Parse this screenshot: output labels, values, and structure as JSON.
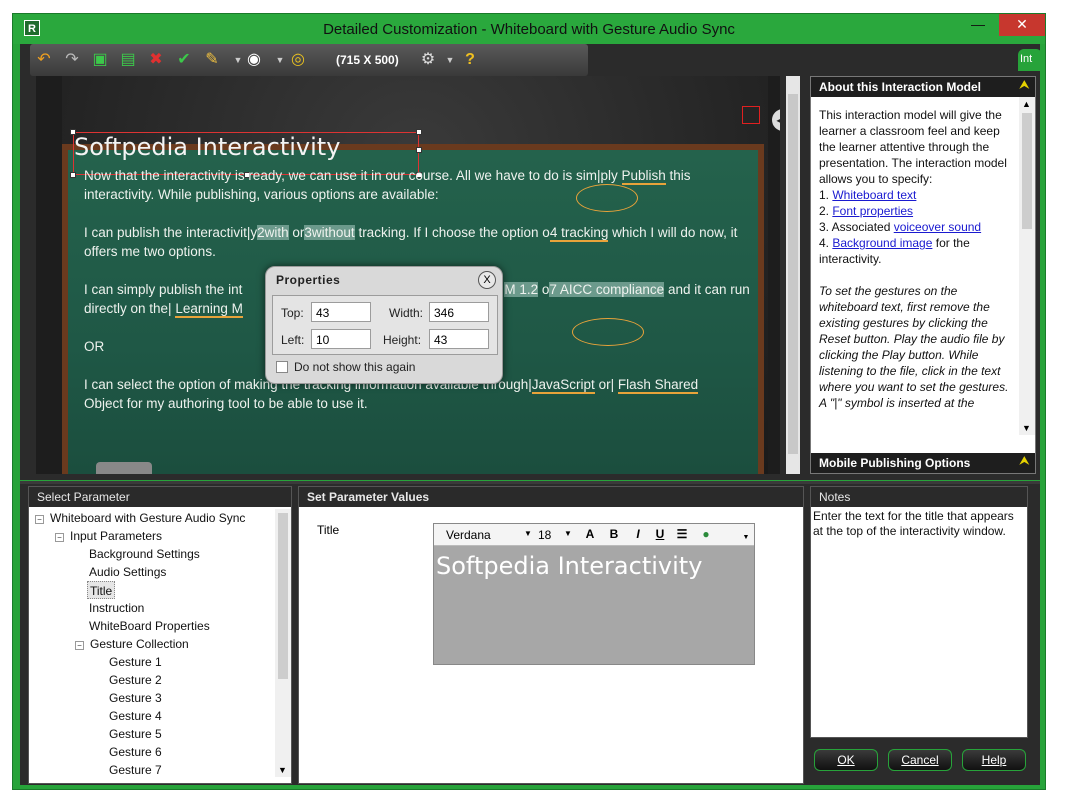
{
  "window": {
    "title": "Detailed Customization - Whiteboard with Gesture Audio Sync",
    "app_icon": "R",
    "minimize": "—",
    "close": "✕"
  },
  "toolbar": {
    "dimensions": "(715 X 500)",
    "tab_label": "Int",
    "icons": [
      "undo-icon",
      "redo-icon",
      "save-icon",
      "save-all-icon",
      "delete-icon",
      "check-icon",
      "paint-icon",
      "eye-icon",
      "target-icon",
      "gear-icon",
      "help-icon"
    ]
  },
  "whiteboard": {
    "title": "Softpedia Interactivity",
    "speaker": "◀)",
    "p1_a": "Now that the interactivity is ready, we can use it in our course. All we have to do is sim|ply ",
    "p1_hl": "Publish",
    "p1_b": " this interactivity. While publishing, various options are available:",
    "p2_a": "I can publish the interactivit|y",
    "p2_m1": "2with",
    "p2_b": " or",
    "p2_m2": "3without",
    "p2_c": " tracking. If I choose the option o",
    "p2_hl": "4 tracking",
    "p2_d": " which I will do now, it offers me two options.",
    "p3_a": "I can simply publish the int",
    "p3_m": "M 1.2",
    "p3_b": " o",
    "p3_c": "7 AICC compliance",
    "p3_d": " and it can run directly on the| ",
    "p3_hl": "Learning M",
    "p4": "OR",
    "p5_a": "I can select the option of making the tracking information available through|",
    "p5_hl1": "JavaScript",
    "p5_b": " or| ",
    "p5_hl2": "Flash Shared",
    "p5_c": "Object for my authoring tool to be able to use it."
  },
  "properties": {
    "title": "Properties",
    "close": "X",
    "top_label": "Top:",
    "top_value": "43",
    "width_label": "Width:",
    "width_value": "346",
    "left_label": "Left:",
    "left_value": "10",
    "height_label": "Height:",
    "height_value": "43",
    "no_show": "Do not show this again"
  },
  "about": {
    "header": "About this Interaction Model",
    "chevron": "⮝",
    "intro": "This interaction model will give the learner a classroom feel and keep the learner attentive through the presentation. The interaction model allows you to specify:",
    "item1_num": "1. ",
    "item1_link": "Whiteboard text",
    "item2_num": "2. ",
    "item2_link": "Font properties",
    "item3_num": "3. Associated ",
    "item3_link": "voiceover sound",
    "item4_num": "4. ",
    "item4_link": "Background image",
    "item4_tail": " for the interactivity.",
    "italic": "To set the gestures on the whiteboard text, first remove the existing gestures by clicking the Reset button. Play the audio file by clicking the Play button. While listening to the file, click in the text where you want to set the gestures. A \"|\" symbol is inserted at the",
    "footer": "Mobile Publishing Options"
  },
  "select_param": {
    "header": "Select Parameter",
    "root": "Whiteboard with Gesture Audio Sync",
    "input_params": "Input Parameters",
    "items": [
      "Background Settings",
      "Audio Settings",
      "Title",
      "Instruction",
      "WhiteBoard Properties"
    ],
    "gesture_collection": "Gesture Collection",
    "gestures": [
      "Gesture  1",
      "Gesture  2",
      "Gesture  3",
      "Gesture  4",
      "Gesture  5",
      "Gesture  6",
      "Gesture  7"
    ]
  },
  "set_values": {
    "header": "Set Parameter Values",
    "field_label": "Title",
    "font": "Verdana",
    "size": "18",
    "bold": "B",
    "italic": "I",
    "underline": "U",
    "content": "Softpedia Interactivity"
  },
  "notes": {
    "header": "Notes",
    "text": "Enter the text for the title that appears at the top of the interactivity window."
  },
  "buttons": {
    "ok": "OK",
    "cancel": "Cancel",
    "help": "Help"
  }
}
